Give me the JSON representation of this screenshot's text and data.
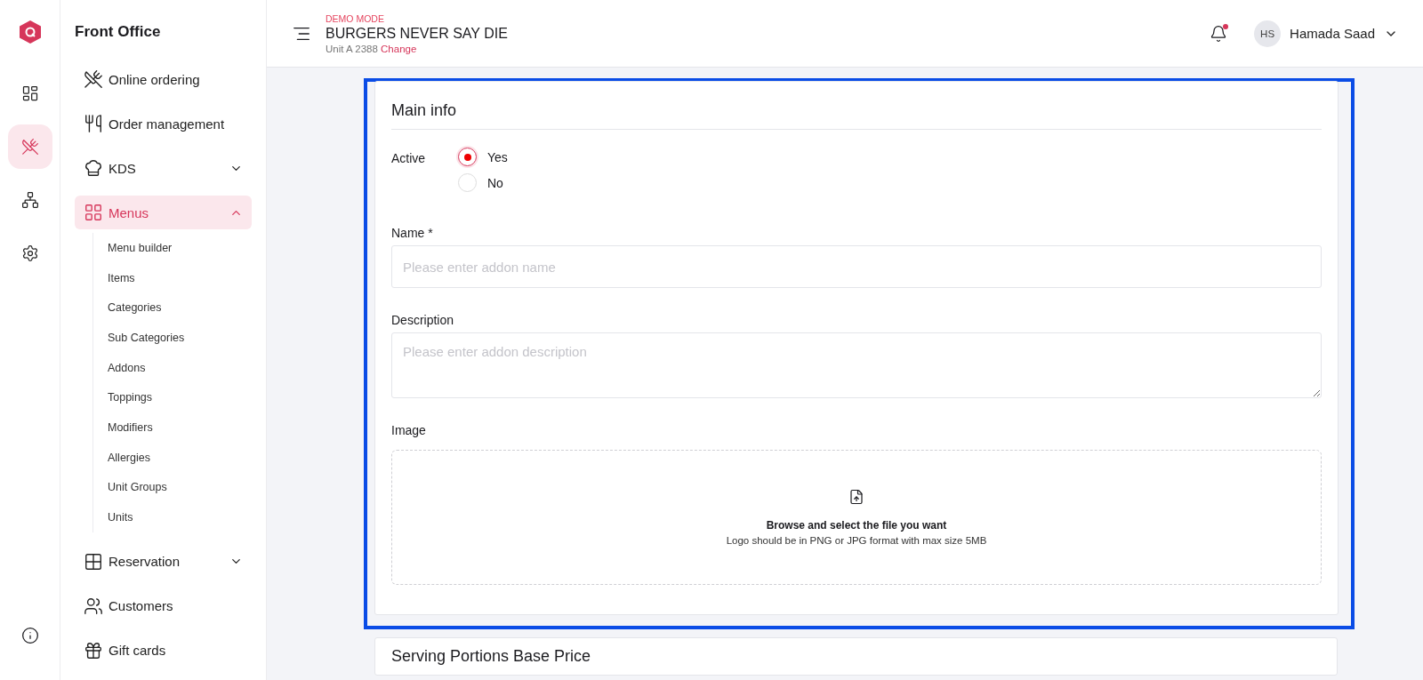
{
  "rail": {
    "items": [
      {
        "selected": false
      },
      {
        "selected": true
      },
      {
        "selected": false
      },
      {
        "selected": false
      }
    ]
  },
  "sidebar": {
    "title": "Front Office",
    "items": [
      {
        "label": "Online ordering",
        "selected": false
      },
      {
        "label": "Order management",
        "selected": false
      },
      {
        "label": "KDS",
        "selected": false,
        "expanded": false
      },
      {
        "label": "Menus",
        "selected": true,
        "expanded": true,
        "children": [
          {
            "label": "Menu builder"
          },
          {
            "label": "Items"
          },
          {
            "label": "Categories"
          },
          {
            "label": "Sub Categories"
          },
          {
            "label": "Addons"
          },
          {
            "label": "Toppings"
          },
          {
            "label": "Modifiers"
          },
          {
            "label": "Allergies"
          },
          {
            "label": "Unit Groups"
          },
          {
            "label": "Units"
          }
        ]
      },
      {
        "label": "Reservation",
        "selected": false,
        "expanded": false
      },
      {
        "label": "Customers",
        "selected": false
      },
      {
        "label": "Gift cards",
        "selected": false
      }
    ]
  },
  "header": {
    "mode": "DEMO MODE",
    "business": "BURGERS NEVER SAY DIE",
    "unit": "Unit A 2388",
    "change_link": "Change",
    "notification": true,
    "user": {
      "initials": "HS",
      "name": "Hamada Saad"
    }
  },
  "main_info": {
    "title": "Main info",
    "active": {
      "label": "Active",
      "options": [
        {
          "label": "Yes",
          "selected": true
        },
        {
          "label": "No",
          "selected": false
        }
      ]
    },
    "name": {
      "label": "Name *",
      "placeholder": "Please enter addon name"
    },
    "description": {
      "label": "Description",
      "placeholder": "Please enter addon description"
    },
    "image": {
      "label": "Image",
      "title": "Browse and select the file you want",
      "hint": "Logo should be in PNG or JPG format with max size 5MB"
    }
  },
  "next_section": {
    "title": "Serving Portions Base Price"
  }
}
